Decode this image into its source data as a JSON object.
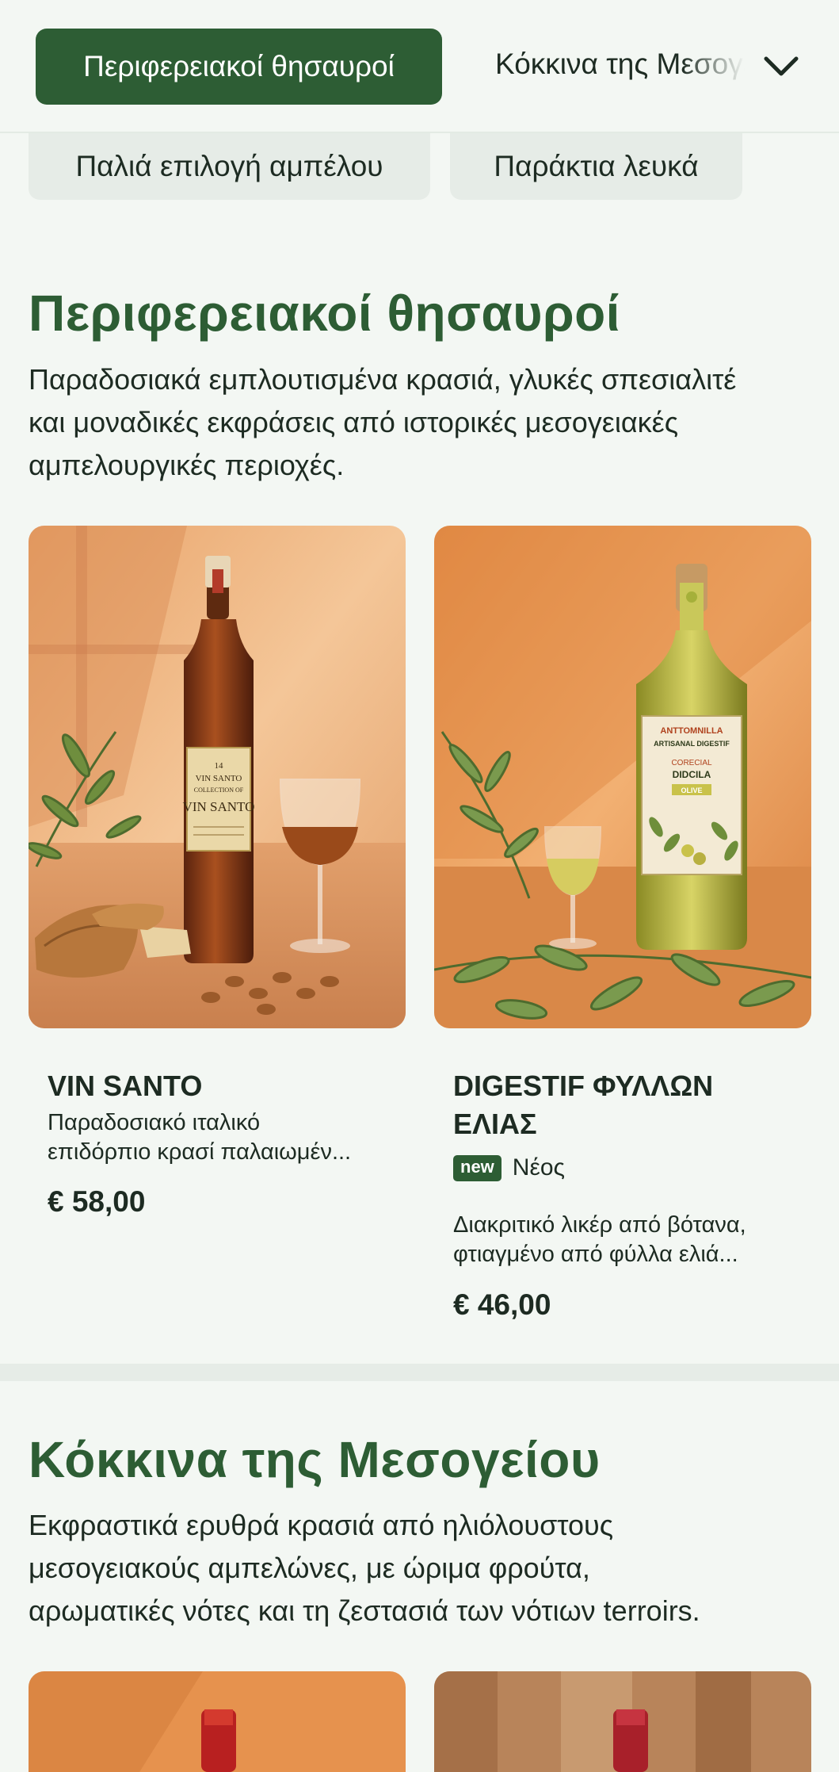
{
  "category_bar": {
    "active": "Περιφερειακοί θησαυροί",
    "next": "Κόκκινα της Μεσογείου",
    "sub_items": [
      "Παλιά επιλογή αμπέλου",
      "Παράκτια λευκά"
    ]
  },
  "sections": [
    {
      "title": "Περιφερειακοί θησαυροί",
      "description_lines": [
        "Παραδοσιακά εμπλουτισμένα κρασιά, γλυκές σπεσιαλιτέ",
        "και μοναδικές εκφράσεις από ιστορικές μεσογειακές",
        "αμπελουργικές περιοχές."
      ],
      "products": [
        {
          "name": "VIN SANTO",
          "description_lines": [
            "Παραδοσιακό ιταλικό",
            "επιδόρπιο κρασί παλαιωμέν..."
          ],
          "price": "€ 58,00",
          "label_text": [
            "14",
            "VIN SANTO",
            "COLLECTION OF",
            "VIN SANTO"
          ]
        },
        {
          "name_lines": [
            "DIGESTIF ΦΥΛΛΩΝ",
            "ΕΛΙΑΣ"
          ],
          "badge": "new",
          "badge_label": "Νέος",
          "description_lines": [
            "Διακριτικό λικέρ από βότανα,",
            "φτιαγμένο από φύλλα ελιά..."
          ],
          "price": "€ 46,00",
          "label_text": [
            "ANTTOMNILLA",
            "ARTISANAL DIGESTIF",
            "CORECIAL",
            "DIDCILA",
            "OLIVE"
          ]
        }
      ]
    },
    {
      "title": "Κόκκινα της Μεσογείου",
      "description_lines": [
        "Εκφραστικά ερυθρά κρασιά από ηλιόλουστους",
        "μεσογειακούς αμπελώνες, με ώριμα φρούτα,",
        "αρωματικές νότες και τη ζεστασιά των νότιων terroirs."
      ]
    }
  ],
  "colors": {
    "brand_green": "#2d5d34",
    "background": "#f3f7f3",
    "pill_bg": "#e6ece7"
  },
  "icons": {
    "dropdown": "chevron-down-icon"
  }
}
